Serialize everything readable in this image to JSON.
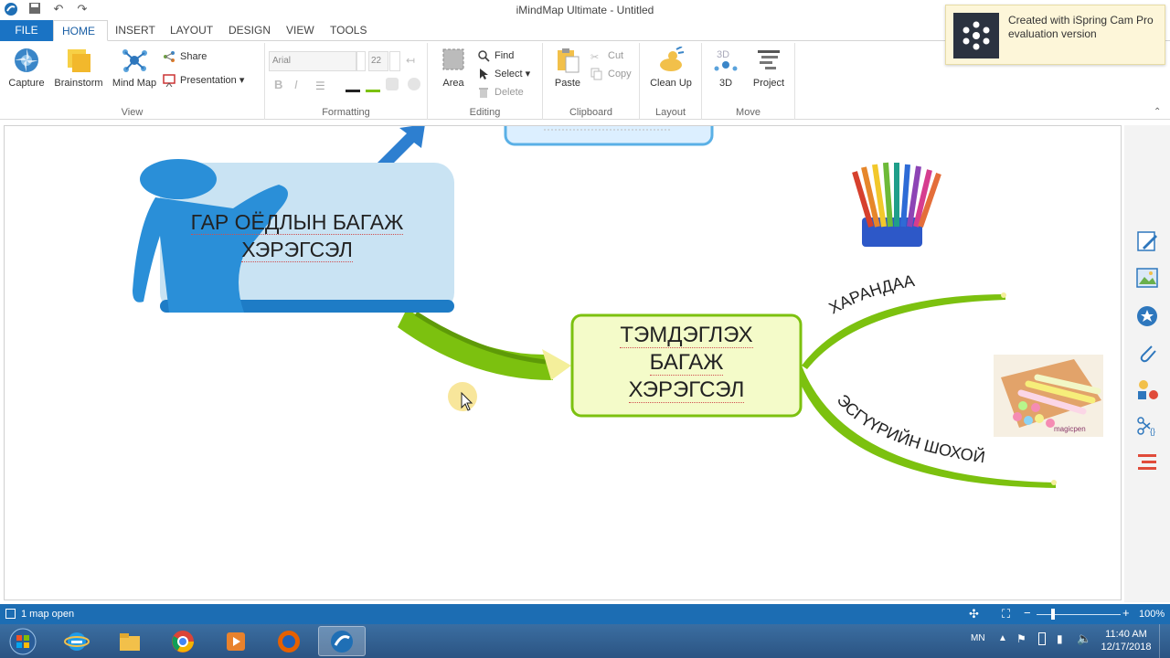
{
  "window": {
    "title": "iMindMap Ultimate - Untitled"
  },
  "tabs": [
    {
      "label": "FILE"
    },
    {
      "label": "HOME"
    },
    {
      "label": "INSERT"
    },
    {
      "label": "LAYOUT"
    },
    {
      "label": "DESIGN"
    },
    {
      "label": "VIEW"
    },
    {
      "label": "TOOLS"
    }
  ],
  "ribbon": {
    "view": {
      "label": "View",
      "capture": "Capture",
      "brainstorm": "Brainstorm",
      "mindmap": "Mind Map",
      "share": "Share",
      "presentation": "Presentation ▾"
    },
    "formatting": {
      "label": "Formatting",
      "font": "Arial",
      "size": "22",
      "bold": "B",
      "italic": "I"
    },
    "editing": {
      "label": "Editing",
      "area": "Area",
      "find": "Find",
      "select": "Select ▾",
      "delete": "Delete"
    },
    "clipboard": {
      "label": "Clipboard",
      "paste": "Paste",
      "cut": "Cut",
      "copy": "Copy"
    },
    "layout": {
      "label": "Layout",
      "cleanup": "Clean Up"
    },
    "move": {
      "label": "Move",
      "threed": "3D",
      "project": "Project",
      "threed_icon_text": "3D"
    }
  },
  "notice": {
    "line1": "Created with iSpring Cam Pro",
    "line2": "evaluation version"
  },
  "mindmap": {
    "left_node": {
      "line1": "ГАР ОЁДЛЫН БАГАЖ",
      "line2": "ХЭРЭГСЭЛ"
    },
    "central_node": {
      "line1": "ТЭМДЭГЛЭХ",
      "line2": "БАГАЖ",
      "line3": "ХЭРЭГСЭЛ"
    },
    "branch_top": "ХАРАНДАА",
    "branch_bottom": "ЭСГҮҮРИЙН ШОХОЙ",
    "image_label": "magicpen"
  },
  "status": {
    "maps_open": "1 map open",
    "zoom": "100%"
  },
  "taskbar": {
    "lang": "MN",
    "time": "11:40 AM",
    "date": "12/17/2018"
  },
  "colors": {
    "accent": "#1c6db3",
    "branch_green": "#7cc10f",
    "central_fill": "#f4fbc9",
    "node_blue": "#c9e3f3"
  }
}
